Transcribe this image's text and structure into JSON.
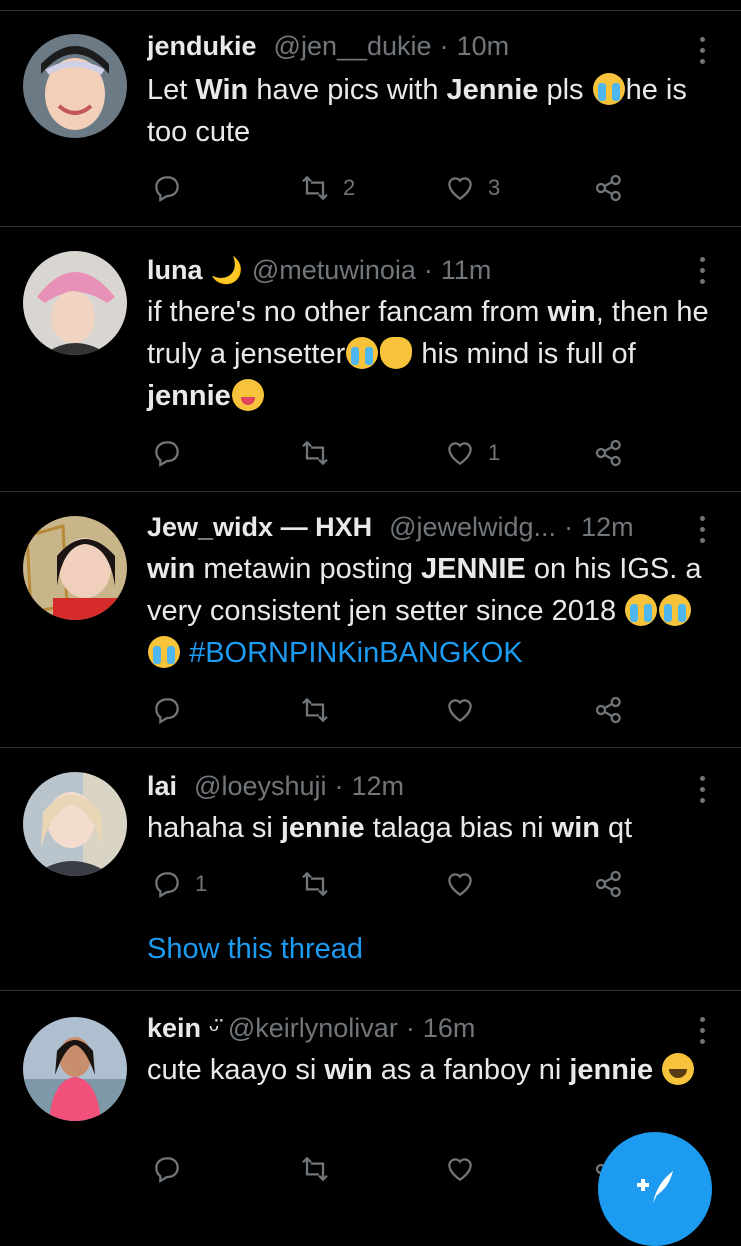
{
  "tweets": [
    {
      "name": "jendukie",
      "flair": "",
      "handle": "@jen__dukie",
      "time": "10m",
      "body": [
        {
          "t": "Let "
        },
        {
          "t": "Win",
          "b": true
        },
        {
          "t": " have pics with "
        },
        {
          "t": "Jennie",
          "b": true
        },
        {
          "t": " pls "
        },
        {
          "e": "loudly-crying-face"
        },
        {
          "t": "he is too cute"
        }
      ],
      "reply_count": "",
      "retweet_count": "2",
      "like_count": "3",
      "show_thread": ""
    },
    {
      "name": "luna",
      "flair": "🌙",
      "handle": "@metuwinoia",
      "time": "11m",
      "body": [
        {
          "t": "if there's no other fancam from "
        },
        {
          "t": "win",
          "b": true
        },
        {
          "t": ", then he truly a jensetter"
        },
        {
          "e": "face-with-tears-of-joy"
        },
        {
          "e": "heart-hands"
        },
        {
          "t": " his mind is full of "
        },
        {
          "t": "jennie",
          "b": true
        },
        {
          "e": "face-savoring-food"
        }
      ],
      "reply_count": "",
      "retweet_count": "",
      "like_count": "1",
      "show_thread": ""
    },
    {
      "name": "Jew_widx — HXH",
      "flair": "",
      "handle": "@jewelwidg...",
      "time": "12m",
      "body": [
        {
          "t": "win",
          "b": true
        },
        {
          "t": " metawin posting "
        },
        {
          "t": "JENNIE",
          "b": true
        },
        {
          "t": " on his IGS. a very consistent jen setter since 2018 "
        },
        {
          "e": "loudly-crying-face"
        },
        {
          "e": "loudly-crying-face"
        },
        {
          "e": "loudly-crying-face"
        },
        {
          "t": " "
        },
        {
          "h": "#BORNPINKinBANGKOK"
        }
      ],
      "reply_count": "",
      "retweet_count": "",
      "like_count": "",
      "show_thread": ""
    },
    {
      "name": "lai",
      "flair": "",
      "handle": "@loeyshuji",
      "time": "12m",
      "body": [
        {
          "t": "hahaha si "
        },
        {
          "t": "jennie",
          "b": true
        },
        {
          "t": " talaga bias ni "
        },
        {
          "t": "win",
          "b": true
        },
        {
          "t": " qt"
        }
      ],
      "reply_count": "1",
      "retweet_count": "",
      "like_count": "",
      "show_thread": "Show this thread"
    },
    {
      "name": "kein",
      "flair": "ᵕ̈",
      "handle": "@keirlynolivar",
      "time": "16m",
      "body": [
        {
          "t": "cute kaayo si "
        },
        {
          "t": "win",
          "b": true
        },
        {
          "t": " as a fanboy ni "
        },
        {
          "t": "jennie",
          "b": true
        },
        {
          "t": " "
        },
        {
          "e": "grinning-squinting-face"
        }
      ],
      "reply_count": "",
      "retweet_count": "",
      "like_count": "",
      "show_thread": ""
    }
  ],
  "icons": {
    "reply": "reply-icon",
    "retweet": "retweet-icon",
    "like": "heart-icon",
    "share": "share-icon",
    "more": "more-options-icon",
    "compose": "compose-tweet-icon"
  },
  "colors": {
    "background": "#000000",
    "text": "#e7e9ea",
    "muted": "#71767b",
    "accent": "#1d9bf0",
    "divider": "#2f3336"
  }
}
